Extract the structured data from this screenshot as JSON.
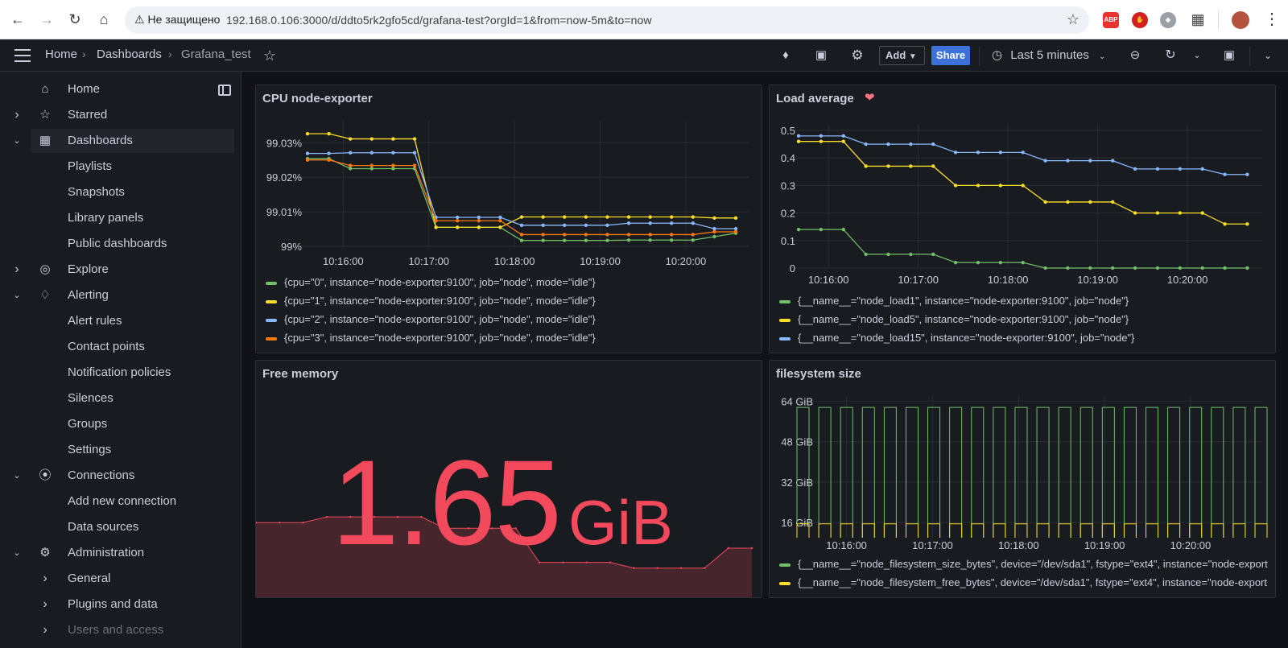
{
  "browser": {
    "security_label": "Не защищено",
    "url": "192.168.0.106:3000/d/ddto5rk2gfo5cd/grafana-test?orgId=1&from=now-5m&to=now"
  },
  "topnav": {
    "breadcrumbs": [
      "Home",
      "Dashboards",
      "Grafana_test"
    ],
    "add_label": "Add",
    "share_label": "Share",
    "time_range": "Last 5 minutes"
  },
  "sidebar": {
    "items": [
      {
        "label": "Home",
        "icon": "home-icon",
        "chevron": ""
      },
      {
        "label": "Starred",
        "icon": "star-icon",
        "chevron": "right"
      },
      {
        "label": "Dashboards",
        "icon": "dashboards-icon",
        "chevron": "down",
        "active": true
      },
      {
        "label": "Playlists",
        "sub": true
      },
      {
        "label": "Snapshots",
        "sub": true
      },
      {
        "label": "Library panels",
        "sub": true
      },
      {
        "label": "Public dashboards",
        "sub": true
      },
      {
        "label": "Explore",
        "icon": "compass-icon",
        "chevron": "right"
      },
      {
        "label": "Alerting",
        "icon": "bell-icon",
        "chevron": "down"
      },
      {
        "label": "Alert rules",
        "sub": true
      },
      {
        "label": "Contact points",
        "sub": true
      },
      {
        "label": "Notification policies",
        "sub": true
      },
      {
        "label": "Silences",
        "sub": true
      },
      {
        "label": "Groups",
        "sub": true
      },
      {
        "label": "Settings",
        "sub": true
      },
      {
        "label": "Connections",
        "icon": "connections-icon",
        "chevron": "down"
      },
      {
        "label": "Add new connection",
        "sub": true
      },
      {
        "label": "Data sources",
        "sub": true
      },
      {
        "label": "Administration",
        "icon": "gear-icon",
        "chevron": "down"
      },
      {
        "label": "General",
        "sub": true,
        "chevron": "right"
      },
      {
        "label": "Plugins and data",
        "sub": true,
        "chevron": "right"
      },
      {
        "label": "Users and access",
        "sub": true,
        "chevron": "right",
        "dim": true
      }
    ]
  },
  "panels": {
    "cpu": {
      "title": "CPU node-exporter",
      "legend": [
        "{cpu=\"0\", instance=\"node-exporter:9100\", job=\"node\", mode=\"idle\"}",
        "{cpu=\"1\", instance=\"node-exporter:9100\", job=\"node\", mode=\"idle\"}",
        "{cpu=\"2\", instance=\"node-exporter:9100\", job=\"node\", mode=\"idle\"}",
        "{cpu=\"3\", instance=\"node-exporter:9100\", job=\"node\", mode=\"idle\"}"
      ]
    },
    "load": {
      "title": "Load average",
      "legend": [
        "{__name__=\"node_load1\", instance=\"node-exporter:9100\", job=\"node\"}",
        "{__name__=\"node_load5\", instance=\"node-exporter:9100\", job=\"node\"}",
        "{__name__=\"node_load15\", instance=\"node-exporter:9100\", job=\"node\"}"
      ]
    },
    "memory": {
      "title": "Free memory",
      "value": "1.65",
      "unit": "GiB"
    },
    "fs": {
      "title": "filesystem size",
      "legend": [
        "{__name__=\"node_filesystem_size_bytes\", device=\"/dev/sda1\", fstype=\"ext4\", instance=\"node-export",
        "{__name__=\"node_filesystem_free_bytes\", device=\"/dev/sda1\", fstype=\"ext4\", instance=\"node-export"
      ]
    }
  },
  "colors": {
    "green": "#73bf69",
    "yellow": "#fade2a",
    "blue": "#8ab8ff",
    "orange": "#ff780a",
    "red": "#f2495c"
  },
  "chart_data": [
    {
      "type": "line",
      "title": "CPU node-exporter",
      "x_ticks": [
        "10:16:00",
        "10:17:00",
        "10:18:00",
        "10:19:00",
        "10:20:00"
      ],
      "y_ticks": [
        "99%",
        "99.01%",
        "99.02%",
        "99.03%"
      ],
      "ylim": [
        99.0,
        99.0345
      ],
      "x_minutes": [
        0.0,
        0.0,
        0.0
      ],
      "x": [
        "10:15:35",
        "10:15:50",
        "10:16:05",
        "10:16:20",
        "10:16:35",
        "10:16:50",
        "10:17:05",
        "10:17:20",
        "10:17:35",
        "10:17:50",
        "10:18:05",
        "10:18:20",
        "10:18:35",
        "10:18:50",
        "10:19:05",
        "10:19:20",
        "10:19:35",
        "10:19:50",
        "10:20:05",
        "10:20:20",
        "10:20:35"
      ],
      "series": [
        {
          "name": "{cpu=\"0\", instance=\"node-exporter:9100\", job=\"node\", mode=\"idle\"}",
          "color": "#73bf69",
          "values": [
            99.0254,
            99.0254,
            99.0225,
            99.0225,
            99.0225,
            99.0225,
            99.0055,
            99.0055,
            99.0055,
            99.0055,
            99.0017,
            99.0017,
            99.0017,
            99.0017,
            99.0017,
            99.0018,
            99.0018,
            99.0018,
            99.0018,
            99.0028,
            99.0038
          ]
        },
        {
          "name": "{cpu=\"1\", instance=\"node-exporter:9100\", job=\"node\", mode=\"idle\"}",
          "color": "#fade2a",
          "values": [
            99.0326,
            99.0326,
            99.0311,
            99.0311,
            99.0311,
            99.0311,
            99.0055,
            99.0055,
            99.0055,
            99.0055,
            99.0085,
            99.0085,
            99.0085,
            99.0085,
            99.0085,
            99.0085,
            99.0085,
            99.0085,
            99.0085,
            99.0082,
            99.0082
          ]
        },
        {
          "name": "{cpu=\"2\", instance=\"node-exporter:9100\", job=\"node\", mode=\"idle\"}",
          "color": "#8ab8ff",
          "values": [
            99.0269,
            99.0269,
            99.0271,
            99.0271,
            99.0271,
            99.0271,
            99.0084,
            99.0084,
            99.0084,
            99.0084,
            99.0061,
            99.0061,
            99.0061,
            99.0061,
            99.0061,
            99.0067,
            99.0067,
            99.0067,
            99.0067,
            99.0051,
            99.0051
          ]
        },
        {
          "name": "{cpu=\"3\", instance=\"node-exporter:9100\", job=\"node\", mode=\"idle\"}",
          "color": "#ff780a",
          "values": [
            99.025,
            99.025,
            99.0234,
            99.0234,
            99.0234,
            99.0234,
            99.0074,
            99.0074,
            99.0074,
            99.0074,
            99.0034,
            99.0034,
            99.0034,
            99.0034,
            99.0034,
            99.0034,
            99.0034,
            99.0034,
            99.0034,
            99.0042,
            99.0042
          ]
        }
      ]
    },
    {
      "type": "line",
      "title": "Load average",
      "x_ticks": [
        "10:16:00",
        "10:17:00",
        "10:18:00",
        "10:19:00",
        "10:20:00"
      ],
      "y_ticks": [
        "0",
        "0.1",
        "0.2",
        "0.3",
        "0.4",
        "0.5"
      ],
      "ylim": [
        0,
        0.5
      ],
      "x": [
        "10:15:40",
        "10:15:55",
        "10:16:10",
        "10:16:25",
        "10:16:40",
        "10:16:55",
        "10:17:10",
        "10:17:25",
        "10:17:40",
        "10:17:55",
        "10:18:10",
        "10:18:25",
        "10:18:40",
        "10:18:55",
        "10:19:10",
        "10:19:25",
        "10:19:40",
        "10:19:55",
        "10:20:10",
        "10:20:25",
        "10:20:40"
      ],
      "series": [
        {
          "name": "{__name__=\"node_load1\", instance=\"node-exporter:9100\", job=\"node\"}",
          "color": "#73bf69",
          "values": [
            0.14,
            0.14,
            0.14,
            0.05,
            0.05,
            0.05,
            0.05,
            0.02,
            0.02,
            0.02,
            0.02,
            0,
            0,
            0,
            0,
            0,
            0,
            0,
            0,
            0,
            0
          ]
        },
        {
          "name": "{__name__=\"node_load5\", instance=\"node-exporter:9100\", job=\"node\"}",
          "color": "#fade2a",
          "values": [
            0.46,
            0.46,
            0.46,
            0.37,
            0.37,
            0.37,
            0.37,
            0.3,
            0.3,
            0.3,
            0.3,
            0.24,
            0.24,
            0.24,
            0.24,
            0.2,
            0.2,
            0.2,
            0.2,
            0.16,
            0.16
          ]
        },
        {
          "name": "{__name__=\"node_load15\", instance=\"node-exporter:9100\", job=\"node\"}",
          "color": "#8ab8ff",
          "values": [
            0.48,
            0.48,
            0.48,
            0.45,
            0.45,
            0.45,
            0.45,
            0.42,
            0.42,
            0.42,
            0.42,
            0.39,
            0.39,
            0.39,
            0.39,
            0.36,
            0.36,
            0.36,
            0.36,
            0.34,
            0.34
          ]
        }
      ]
    },
    {
      "type": "area",
      "title": "Free memory",
      "values": [
        1.74,
        1.74,
        1.74,
        1.76,
        1.76,
        1.76,
        1.76,
        1.76,
        1.72,
        1.72,
        1.72,
        1.72,
        1.6,
        1.6,
        1.6,
        1.6,
        1.58,
        1.58,
        1.58,
        1.58,
        1.65,
        1.65
      ]
    },
    {
      "type": "line",
      "title": "filesystem size",
      "x_ticks": [
        "10:16:00",
        "10:17:00",
        "10:18:00",
        "10:19:00",
        "10:20:00"
      ],
      "y_ticks": [
        "16 GiB",
        "32 GiB",
        "48 GiB",
        "64 GiB"
      ],
      "ylim": [
        10,
        66
      ],
      "pulses": 22,
      "series": [
        {
          "name": "{__name__=\"node_filesystem_size_bytes\", device=\"/dev/sda1\", fstype=\"ext4\", instance=\"node-export",
          "color": "#73bf69",
          "level_gib": 61.5
        },
        {
          "name": "{__name__=\"node_filesystem_free_bytes\", device=\"/dev/sda1\", fstype=\"ext4\", instance=\"node-export",
          "color": "#fade2a",
          "level_gib": 15.5
        }
      ]
    }
  ]
}
